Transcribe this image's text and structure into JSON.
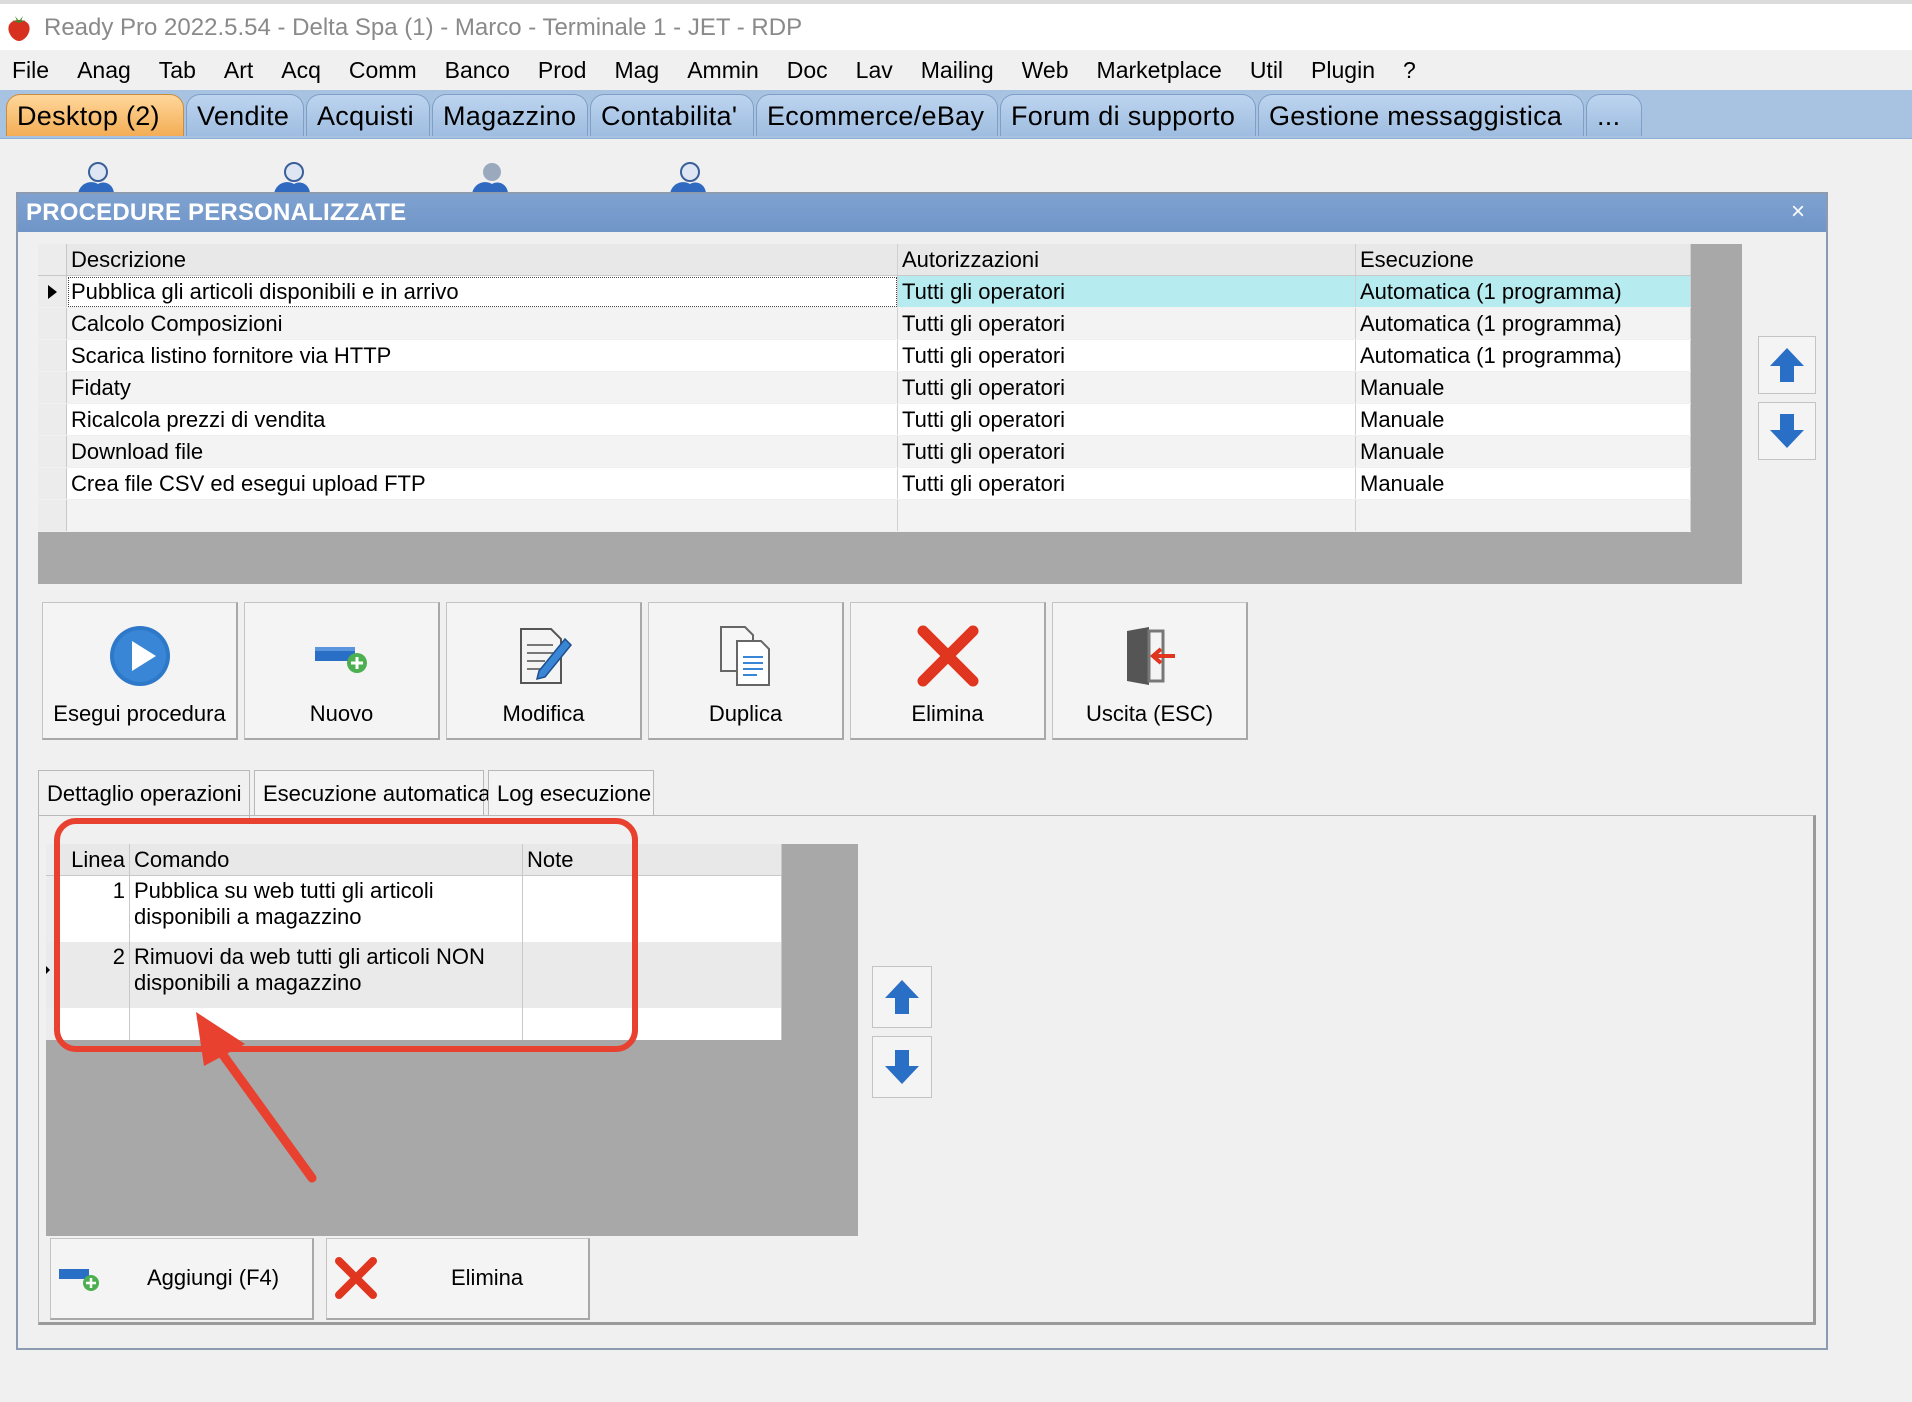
{
  "window": {
    "title": "Ready Pro 2022.5.54 - Delta Spa (1) - Marco - Terminale 1 - JET - RDP"
  },
  "menu": [
    "File",
    "Anag",
    "Tab",
    "Art",
    "Acq",
    "Comm",
    "Banco",
    "Prod",
    "Mag",
    "Ammin",
    "Doc",
    "Lav",
    "Mailing",
    "Web",
    "Marketplace",
    "Util",
    "Plugin",
    "?"
  ],
  "tabs": [
    "Desktop (2)",
    "Vendite",
    "Acquisti",
    "Magazzino",
    "Contabilita'",
    "Ecommerce/eBay",
    "Forum di supporto",
    "Gestione messaggistica",
    "..."
  ],
  "dialog": {
    "title": "PROCEDURE PERSONALIZZATE",
    "close": "×",
    "grid": {
      "columns": [
        "Descrizione",
        "Autorizzazioni",
        "Esecuzione"
      ],
      "rows": [
        [
          "Pubblica gli articoli disponibili e in arrivo",
          "Tutti gli operatori",
          "Automatica (1 programma)"
        ],
        [
          "Calcolo Composizioni",
          "Tutti gli operatori",
          "Automatica (1 programma)"
        ],
        [
          "Scarica listino fornitore via HTTP",
          "Tutti gli operatori",
          "Automatica (1 programma)"
        ],
        [
          "Fidaty",
          "Tutti gli operatori",
          "Manuale"
        ],
        [
          "Ricalcola prezzi di vendita",
          "Tutti gli operatori",
          "Manuale"
        ],
        [
          "Download file",
          "Tutti gli operatori",
          "Manuale"
        ],
        [
          "Crea file CSV ed esegui upload FTP",
          "Tutti gli operatori",
          "Manuale"
        ]
      ]
    },
    "toolbar": {
      "run": "Esegui procedura",
      "new": "Nuovo",
      "edit": "Modifica",
      "duplicate": "Duplica",
      "delete": "Elimina",
      "exit": "Uscita (ESC)"
    },
    "detail_tabs": [
      "Dettaglio operazioni",
      "Esecuzione automatica",
      "Log esecuzione"
    ],
    "ops": {
      "columns": [
        "Linea",
        "Comando",
        "Note"
      ],
      "rows": [
        {
          "line": "1",
          "command": "Pubblica su web tutti gli articoli disponibili a magazzino",
          "note": ""
        },
        {
          "line": "2",
          "command": "Rimuovi da web tutti gli articoli NON disponibili a magazzino",
          "note": ""
        }
      ]
    },
    "bottom": {
      "add": "Aggiungi (F4)",
      "delete": "Elimina"
    }
  },
  "colors": {
    "accent_tab": "#f3ad55",
    "selection": "#b6ebf0",
    "annotation": "#e8412f",
    "title_bar": "#6f95c8"
  }
}
